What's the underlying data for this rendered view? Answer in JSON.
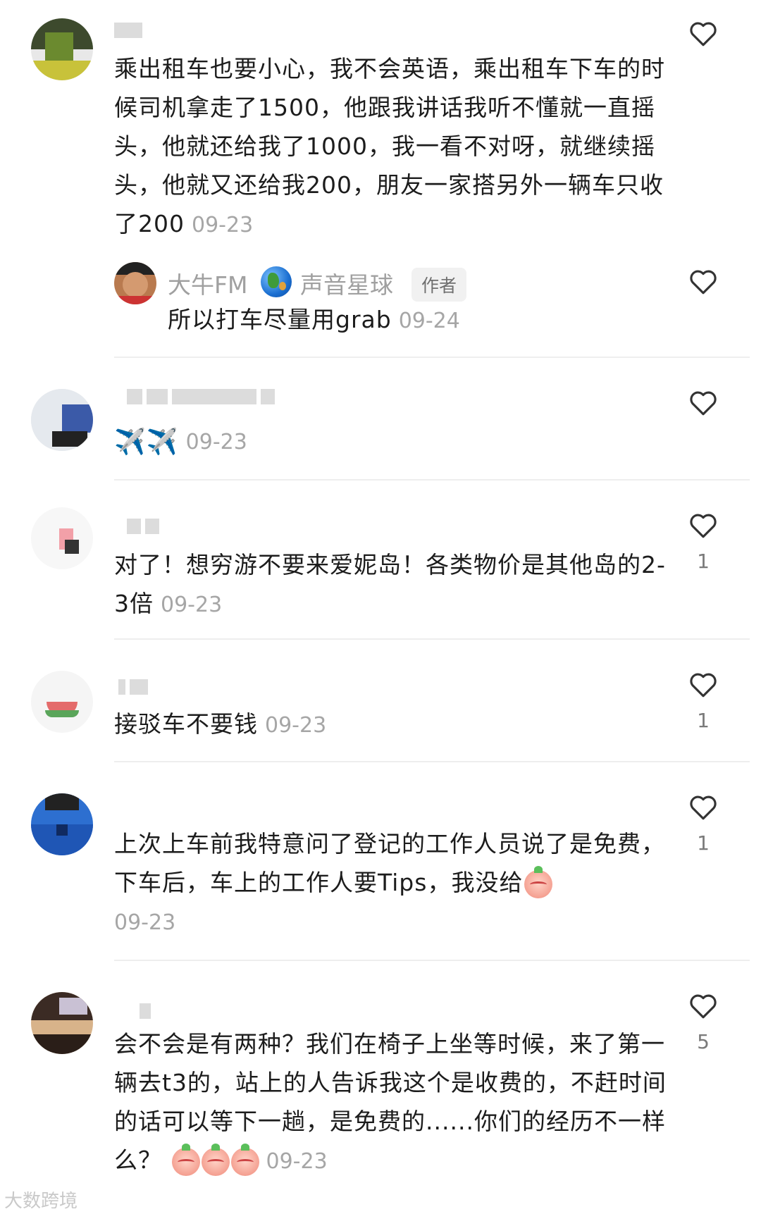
{
  "comments": [
    {
      "text": "乘出租车也要小心，我不会英语，乘出租车下车的时候司机拿走了1500，他跟我讲话我听不懂就一直摇头，他就还给我了1000，我一看不对呀，就继续摇头，他就又还给我200，朋友一家搭另外一辆车只收了200",
      "date": "09-23",
      "likes": "",
      "reply": {
        "name": "大牛FM",
        "planet": "声音星球",
        "badge": "作者",
        "text": "所以打车尽量用grab",
        "date": "09-24",
        "likes": ""
      }
    },
    {
      "text": "✈️✈️",
      "date": "09-23",
      "likes": ""
    },
    {
      "text": "对了！想穷游不要来爱妮岛！各类物价是其他岛的2-3倍",
      "date": "09-23",
      "likes": "1"
    },
    {
      "text": "接驳车不要钱",
      "date": "09-23",
      "likes": "1"
    },
    {
      "text": "上次上车前我特意问了登记的工作人员说了是免费，下车后，车上的工作人要Tips，我没给",
      "date": "09-23",
      "likes": "1"
    },
    {
      "text": "会不会是有两种？我们在椅子上坐等时候，来了第一辆去t3的，站上的人告诉我这个是收费的，不赶时间的话可以等下一趟，是免费的......你们的经历不一样么？",
      "date": "09-23",
      "likes": "5"
    }
  ],
  "watermark": "大数跨境",
  "icons": {
    "like": "heart-outline-icon",
    "planet": "globe-icon"
  },
  "colors": {
    "date": "#a6a6a6",
    "text": "#1c1c1c",
    "badge_bg": "#f1f1f1"
  }
}
